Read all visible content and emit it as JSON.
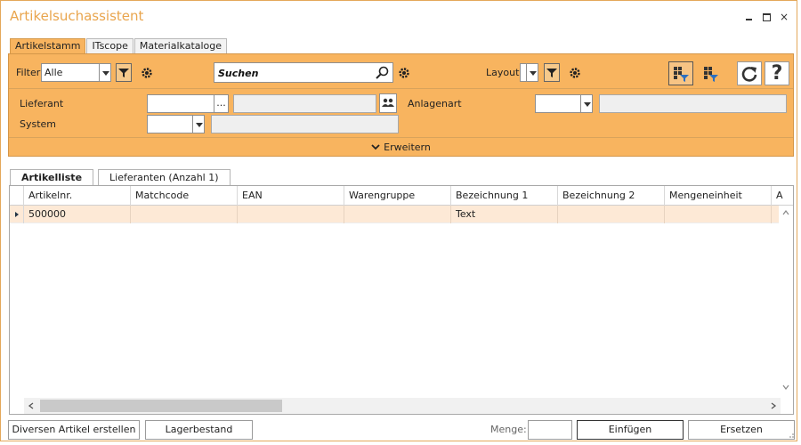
{
  "window": {
    "title": "Artikelsuchassistent",
    "close_glyph": "×"
  },
  "top_tabs": [
    {
      "label": "Artikelstamm",
      "active": true
    },
    {
      "label": "ITscope",
      "active": false
    },
    {
      "label": "Materialkataloge",
      "active": false
    }
  ],
  "toolbar": {
    "filter_label": "Filter",
    "filter_value": "Alle",
    "search_value": "Suchen",
    "layout_label": "Layout",
    "lieferant_label": "Lieferant",
    "lieferant_browse": "...",
    "anlagenart_label": "Anlagenart",
    "system_label": "System",
    "help_glyph": "?",
    "expand_label": "Erweitern"
  },
  "lower_tabs": [
    {
      "label": "Artikelliste",
      "active": true
    },
    {
      "label": "Lieferanten (Anzahl 1)",
      "active": false
    }
  ],
  "grid": {
    "columns": [
      "Artikelnr.",
      "Matchcode",
      "EAN",
      "Warengruppe",
      "Bezeichnung 1",
      "Bezeichnung 2",
      "Mengeneinheit",
      "A"
    ],
    "rows": [
      [
        "500000",
        "",
        "",
        "",
        "Text",
        "",
        "",
        ""
      ]
    ]
  },
  "footer": {
    "diverse_button": "Diversen Artikel erstellen",
    "lager_button": "Lagerbestand",
    "menge_label": "Menge:",
    "einfuegen_button": "Einfügen",
    "ersetzen_button": "Ersetzen"
  },
  "colors": {
    "accent": "#f8b45f",
    "title": "#e9a54d",
    "row_highlight": "#fde9d6"
  }
}
